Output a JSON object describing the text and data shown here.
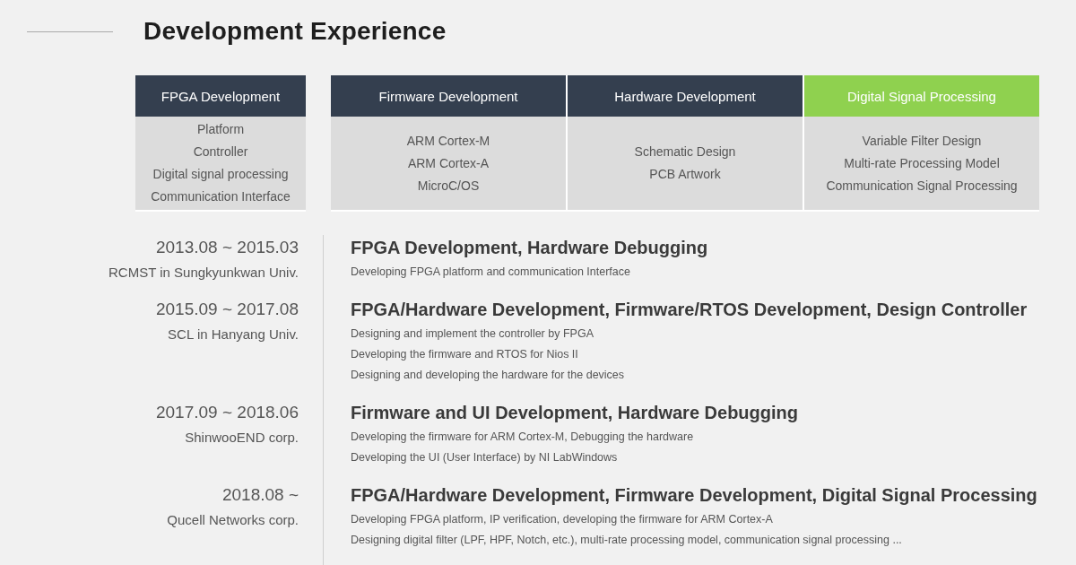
{
  "heading": "Development Experience",
  "skill_groups": [
    {
      "columns": [
        {
          "title": "FPGA Development",
          "color": "#343f4f",
          "items": [
            "Platform",
            "Controller",
            "Digital signal processing",
            "Communication Interface"
          ]
        }
      ]
    },
    {
      "columns": [
        {
          "title": "Firmware Development",
          "color": "#343f4f",
          "items": [
            "ARM Cortex-M",
            "ARM Cortex-A",
            "MicroC/OS"
          ]
        },
        {
          "title": "Hardware Development",
          "color": "#343f4f",
          "items": [
            "Schematic Design",
            "PCB Artwork"
          ]
        },
        {
          "title": "Digital Signal Processing",
          "color": "#8fd14f",
          "items": [
            "Variable Filter Design",
            "Multi-rate Processing Model",
            "Communication Signal Processing"
          ]
        }
      ]
    }
  ],
  "timeline": [
    {
      "period": "2013.08 ~ 2015.03",
      "organization": "RCMST in Sungkyunkwan Univ.",
      "title": "FPGA Development, Hardware Debugging",
      "details": [
        "Developing FPGA platform and communication Interface"
      ]
    },
    {
      "period": "2015.09 ~ 2017.08",
      "organization": "SCL in Hanyang Univ.",
      "title": "FPGA/Hardware Development, Firmware/RTOS Development, Design Controller",
      "details": [
        "Designing and implement the controller by FPGA",
        "Developing the firmware and RTOS for Nios II",
        "Designing and developing the hardware for the devices"
      ]
    },
    {
      "period": "2017.09 ~ 2018.06",
      "organization": "ShinwooEND corp.",
      "title": "Firmware and UI Development, Hardware Debugging",
      "details": [
        "Developing the firmware for ARM Cortex-M, Debugging the hardware",
        "Developing the UI (User Interface) by NI LabWindows"
      ]
    },
    {
      "period": "2018.08 ~",
      "organization": "Qucell Networks corp.",
      "title": "FPGA/Hardware Development, Firmware Development, Digital Signal Processing",
      "details": [
        "Developing FPGA platform, IP verification, developing the firmware for ARM Cortex-A",
        "Designing digital filter (LPF, HPF, Notch, etc.), multi-rate processing model, communication signal processing ..."
      ]
    }
  ]
}
